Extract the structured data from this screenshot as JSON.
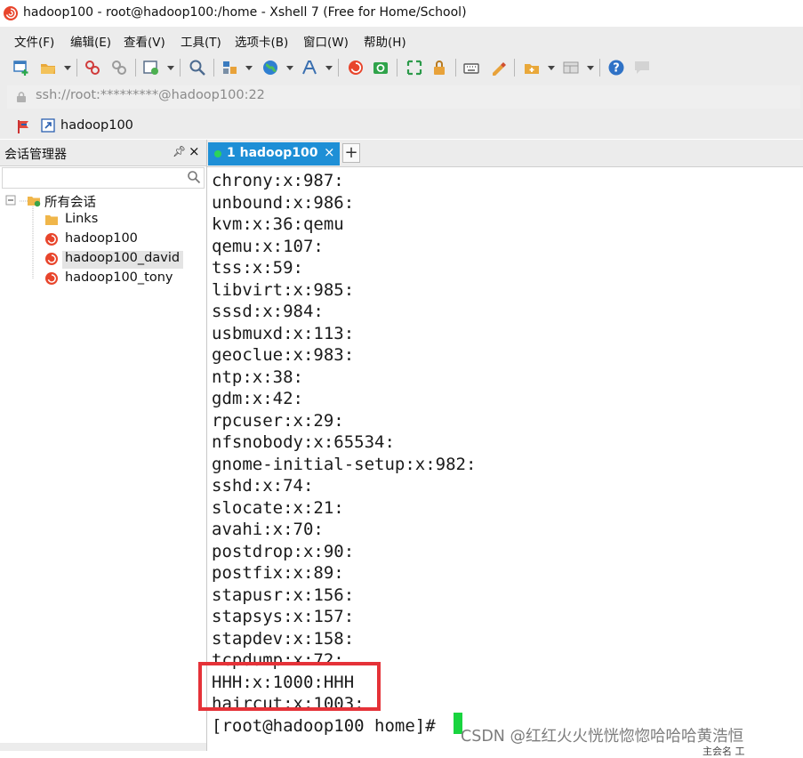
{
  "window": {
    "title": "hadoop100 - root@hadoop100:/home - Xshell 7 (Free for Home/School)"
  },
  "menu": {
    "items": [
      "文件(F)",
      "编辑(E)",
      "查看(V)",
      "工具(T)",
      "选项卡(B)",
      "窗口(W)",
      "帮助(H)"
    ]
  },
  "address": {
    "value": "ssh://root:*********@hadoop100:22"
  },
  "session_bar": {
    "name": "hadoop100"
  },
  "session_manager": {
    "title": "会话管理器",
    "search_value": "",
    "root_label": "所有会话",
    "items": [
      "Links",
      "hadoop100",
      "hadoop100_david",
      "hadoop100_tony"
    ],
    "selected_index": 2
  },
  "tabs": {
    "active_label": "1 hadoop100",
    "add_label": "+"
  },
  "terminal": {
    "lines": [
      "chrony:x:987:",
      "unbound:x:986:",
      "kvm:x:36:qemu",
      "qemu:x:107:",
      "tss:x:59:",
      "libvirt:x:985:",
      "sssd:x:984:",
      "usbmuxd:x:113:",
      "geoclue:x:983:",
      "ntp:x:38:",
      "gdm:x:42:",
      "rpcuser:x:29:",
      "nfsnobody:x:65534:",
      "gnome-initial-setup:x:982:",
      "sshd:x:74:",
      "slocate:x:21:",
      "avahi:x:70:",
      "postdrop:x:90:",
      "postfix:x:89:",
      "stapusr:x:156:",
      "stapsys:x:157:",
      "stapdev:x:158:",
      "tcpdump:x:72:",
      "HHH:x:1000:HHH",
      "haircut:x:1003:",
      "[root@hadoop100 home]# "
    ]
  },
  "watermark": "CSDN @红红火火恍恍惚惚哈哈哈黄浩恒",
  "status": {
    "right_fragment": "主会名   工"
  },
  "colors": {
    "accent_tab": "#1e8fd6",
    "cursor": "#19d43f",
    "highlight": "#e53238",
    "chrome_bg": "#ececec"
  }
}
